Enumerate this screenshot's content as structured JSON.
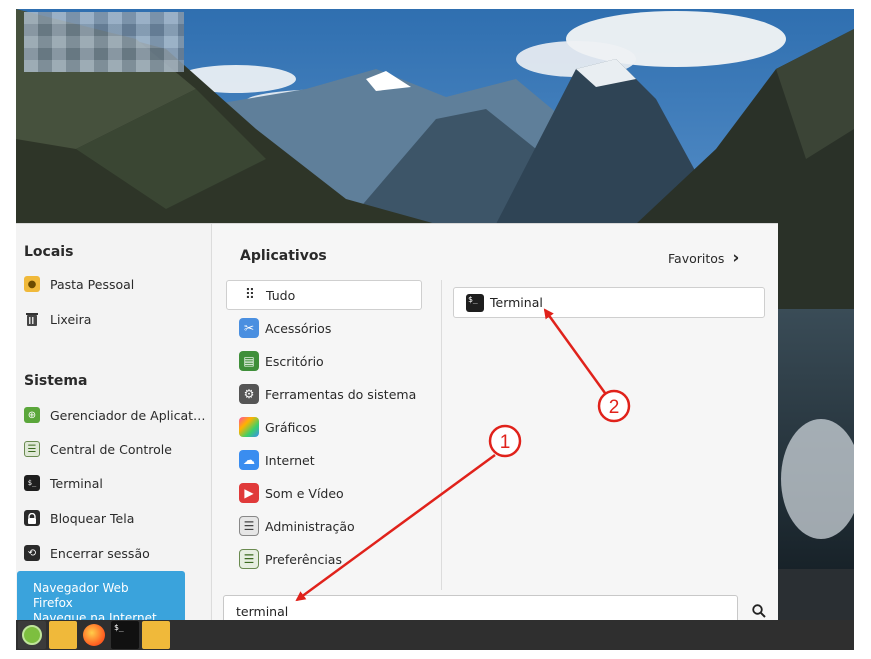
{
  "places": {
    "title": "Locais",
    "items": [
      {
        "label": "Pasta Pessoal",
        "icon": "home-folder-icon"
      },
      {
        "label": "Lixeira",
        "icon": "trash-icon"
      }
    ]
  },
  "system": {
    "title": "Sistema",
    "items": [
      {
        "label": "Gerenciador de Aplicat…",
        "icon": "software-manager-icon"
      },
      {
        "label": "Central de Controle",
        "icon": "control-center-icon"
      },
      {
        "label": "Terminal",
        "icon": "terminal-icon"
      },
      {
        "label": "Bloquear Tela",
        "icon": "lock-icon"
      },
      {
        "label": "Encerrar sessão",
        "icon": "logout-icon"
      }
    ]
  },
  "tooltip": {
    "line1": "Navegador Web Firefox",
    "line2": "Navegue na Internet"
  },
  "apps": {
    "title": "Aplicativos",
    "favorites_label": "Favoritos",
    "categories": [
      {
        "label": "Tudo",
        "icon": "grid-icon",
        "selected": true
      },
      {
        "label": "Acessórios",
        "icon": "accessories-icon"
      },
      {
        "label": "Escritório",
        "icon": "office-icon"
      },
      {
        "label": "Ferramentas do sistema",
        "icon": "gear-icon"
      },
      {
        "label": "Gráficos",
        "icon": "graphics-icon"
      },
      {
        "label": "Internet",
        "icon": "cloud-icon"
      },
      {
        "label": "Som e Vídeo",
        "icon": "play-icon"
      },
      {
        "label": "Administração",
        "icon": "admin-icon"
      },
      {
        "label": "Preferências",
        "icon": "preferences-icon"
      }
    ],
    "results": [
      {
        "label": "Terminal",
        "icon": "terminal-icon"
      }
    ]
  },
  "search": {
    "value": "terminal"
  },
  "annotations": {
    "step1": "1",
    "step2": "2"
  },
  "colors": {
    "tooltip_bg": "#3aa3dc",
    "annotation": "#e0221b",
    "taskbar_bg": "#2f2f2f"
  }
}
